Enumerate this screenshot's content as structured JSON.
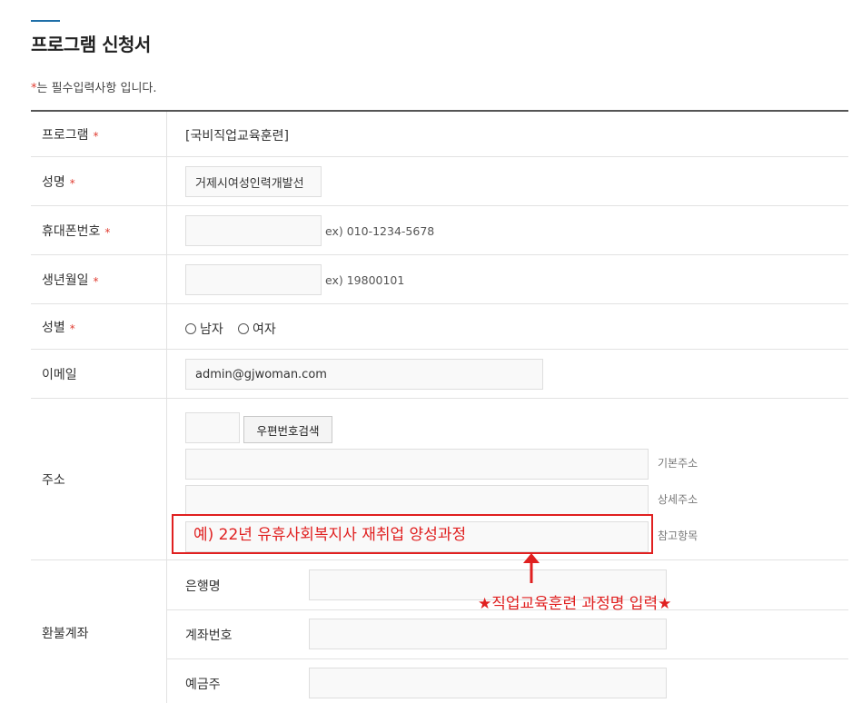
{
  "header": {
    "title": "프로그램 신청서",
    "required_star": "*",
    "required_note": "는 필수입력사항 입니다."
  },
  "fields": {
    "program": {
      "label": "프로그램",
      "value": "[국비직업교육훈련]"
    },
    "name": {
      "label": "성명",
      "value": "거제시여성인력개발선"
    },
    "phone": {
      "label": "휴대폰번호",
      "value": "",
      "hint": "ex) 010-1234-5678"
    },
    "birth": {
      "label": "생년월일",
      "value": "",
      "hint": "ex) 19800101"
    },
    "gender": {
      "label": "성별",
      "options": [
        "남자",
        "여자"
      ]
    },
    "email": {
      "label": "이메일",
      "value": "admin@gjwoman.com"
    },
    "address": {
      "label": "주소",
      "zip_button": "우편번호검색",
      "basic_hint": "기본주소",
      "detail_hint": "상세주소",
      "ref_hint": "참고항목",
      "ref_value": "예) 22년 유휴사회복지사 재취업 양성과정"
    },
    "refund": {
      "label": "환불계좌",
      "bank_label": "은행명",
      "account_label": "계좌번호",
      "holder_label": "예금주"
    }
  },
  "annotation": {
    "caption": "★직업교육훈련 과정명 입력★",
    "color": "#e02020"
  }
}
